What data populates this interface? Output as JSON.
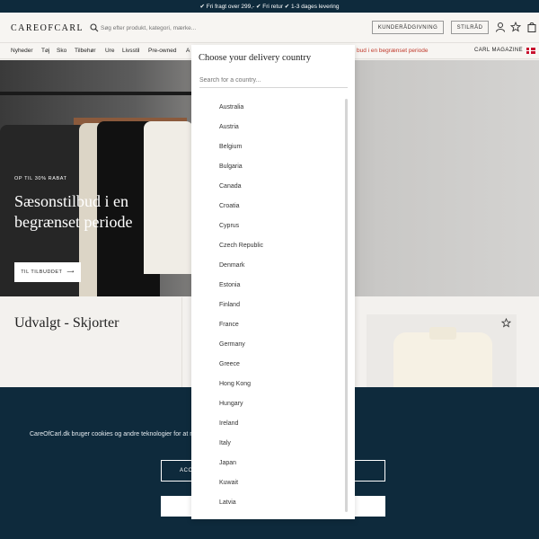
{
  "topbar": {
    "text": "✔ Fri fragt over 299,- ✔ Fri retur ✔ 1-3 dages levering"
  },
  "header": {
    "logo": "CAREOFCARL",
    "search_placeholder": "Søg efter produkt, kategori, mærke...",
    "kunde_button": "KUNDERÅDGIVNING",
    "stil_button": "STILRÅD",
    "icons": [
      "user-icon",
      "star-icon",
      "bag-icon"
    ]
  },
  "nav": {
    "items": [
      "Nyheder",
      "Tøj",
      "Sko",
      "Tilbehør",
      "Ure",
      "Livsstil",
      "Pre-owned",
      "A"
    ],
    "promo": "bud i en begrænset periode",
    "magazine": "CARL MAGAZINE"
  },
  "hero": {
    "small": "OP TIL 30% RABAT",
    "title": "Sæsonstilbud i en begrænset periode",
    "button": "TIL TILBUDDET"
  },
  "section": {
    "title": "Udvalgt - Skjorter"
  },
  "cookie": {
    "text": "CareOfCarl.dk bruger cookies og andre teknologier                                                  for at måle deres ydeevne, for at levere personlige",
    "accept_label": "ACC"
  },
  "country_picker": {
    "title": "Choose your delivery country",
    "search_placeholder": "Search for a country...",
    "countries": [
      "Australia",
      "Austria",
      "Belgium",
      "Bulgaria",
      "Canada",
      "Croatia",
      "Cyprus",
      "Czech Republic",
      "Denmark",
      "Estonia",
      "Finland",
      "France",
      "Germany",
      "Greece",
      "Hong Kong",
      "Hungary",
      "Ireland",
      "Italy",
      "Japan",
      "Kuwait",
      "Latvia"
    ]
  },
  "colors": {
    "navy": "#0e2a3c",
    "promo_red": "#c0392b",
    "background": "#f3f1ee"
  }
}
